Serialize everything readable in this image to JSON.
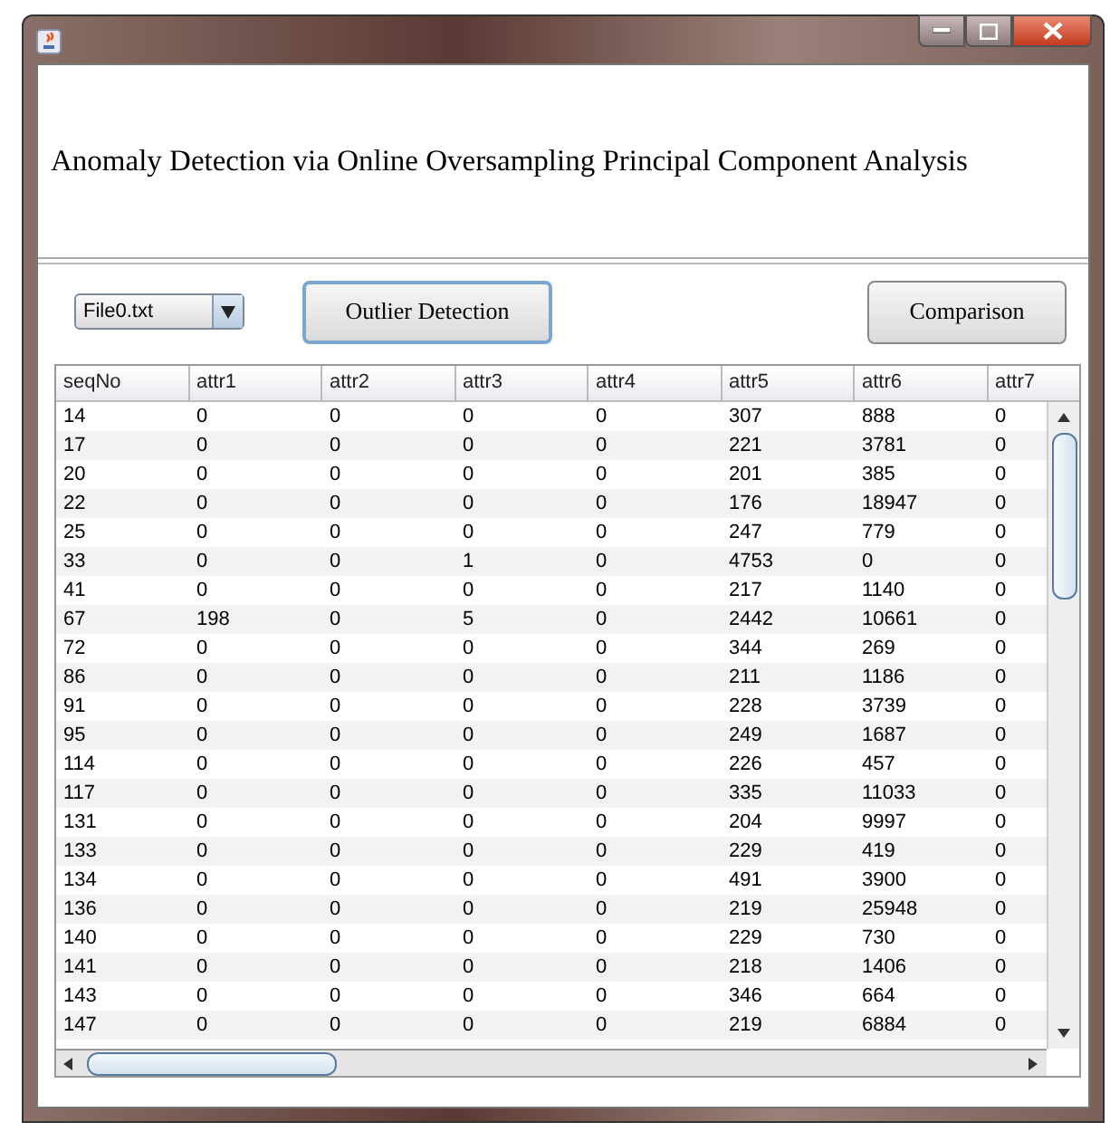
{
  "window": {
    "title": "Anomaly Detection via Online Oversampling Principal Component Analysis"
  },
  "controls": {
    "file_dropdown": {
      "value": "File0.txt"
    },
    "buttons": [
      {
        "label": "Outlier Detection",
        "focused": true
      },
      {
        "label": "Comparison",
        "focused": false
      }
    ]
  },
  "table": {
    "columns": [
      "seqNo",
      "attr1",
      "attr2",
      "attr3",
      "attr4",
      "attr5",
      "attr6",
      "attr7"
    ],
    "rows": [
      [
        "14",
        "0",
        "0",
        "0",
        "0",
        "307",
        "888",
        "0"
      ],
      [
        "17",
        "0",
        "0",
        "0",
        "0",
        "221",
        "3781",
        "0"
      ],
      [
        "20",
        "0",
        "0",
        "0",
        "0",
        "201",
        "385",
        "0"
      ],
      [
        "22",
        "0",
        "0",
        "0",
        "0",
        "176",
        "18947",
        "0"
      ],
      [
        "25",
        "0",
        "0",
        "0",
        "0",
        "247",
        "779",
        "0"
      ],
      [
        "33",
        "0",
        "0",
        "1",
        "0",
        "4753",
        "0",
        "0"
      ],
      [
        "41",
        "0",
        "0",
        "0",
        "0",
        "217",
        "1140",
        "0"
      ],
      [
        "67",
        "198",
        "0",
        "5",
        "0",
        "2442",
        "10661",
        "0"
      ],
      [
        "72",
        "0",
        "0",
        "0",
        "0",
        "344",
        "269",
        "0"
      ],
      [
        "86",
        "0",
        "0",
        "0",
        "0",
        "211",
        "1186",
        "0"
      ],
      [
        "91",
        "0",
        "0",
        "0",
        "0",
        "228",
        "3739",
        "0"
      ],
      [
        "95",
        "0",
        "0",
        "0",
        "0",
        "249",
        "1687",
        "0"
      ],
      [
        "114",
        "0",
        "0",
        "0",
        "0",
        "226",
        "457",
        "0"
      ],
      [
        "117",
        "0",
        "0",
        "0",
        "0",
        "335",
        "11033",
        "0"
      ],
      [
        "131",
        "0",
        "0",
        "0",
        "0",
        "204",
        "9997",
        "0"
      ],
      [
        "133",
        "0",
        "0",
        "0",
        "0",
        "229",
        "419",
        "0"
      ],
      [
        "134",
        "0",
        "0",
        "0",
        "0",
        "491",
        "3900",
        "0"
      ],
      [
        "136",
        "0",
        "0",
        "0",
        "0",
        "219",
        "25948",
        "0"
      ],
      [
        "140",
        "0",
        "0",
        "0",
        "0",
        "229",
        "730",
        "0"
      ],
      [
        "141",
        "0",
        "0",
        "0",
        "0",
        "218",
        "1406",
        "0"
      ],
      [
        "143",
        "0",
        "0",
        "0",
        "0",
        "346",
        "664",
        "0"
      ],
      [
        "147",
        "0",
        "0",
        "0",
        "0",
        "219",
        "6884",
        "0"
      ]
    ]
  }
}
